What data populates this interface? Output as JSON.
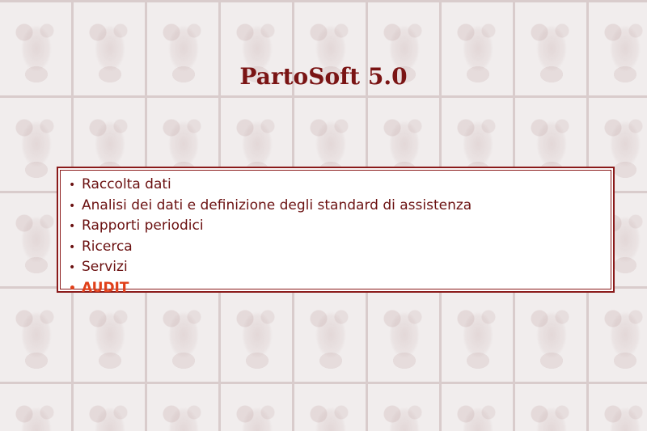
{
  "page": {
    "title": "PartoSoft 5.0"
  },
  "menu": {
    "items": [
      {
        "label": "Raccolta dati"
      },
      {
        "label": "Analisi dei dati e definizione degli standard di assistenza"
      },
      {
        "label": "Rapporti periodici"
      },
      {
        "label": "Ricerca"
      },
      {
        "label": "Servizi"
      },
      {
        "label": "AUDIT",
        "highlighted": true
      }
    ],
    "bullet": "•"
  },
  "colors": {
    "title": "#7a1414",
    "link": "#6b1111",
    "highlight": "#e0401a",
    "border": "#8a1a1a",
    "background": "#f1eded"
  },
  "background": {
    "pattern_icon": "tiled-infant-icon"
  }
}
